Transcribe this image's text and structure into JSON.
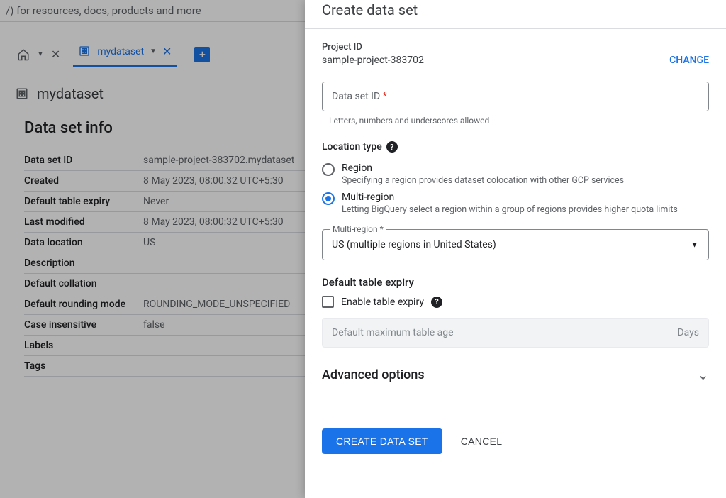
{
  "search": {
    "placeholder_fragment": "/) for resources, docs, products and more"
  },
  "tabs": {
    "dataset_tab": "mydataset"
  },
  "page": {
    "title": "mydataset",
    "section": "Data set info"
  },
  "info_rows": [
    {
      "k": "Data set ID",
      "v": "sample-project-383702.mydataset"
    },
    {
      "k": "Created",
      "v": "8 May 2023, 08:00:32 UTC+5:30"
    },
    {
      "k": "Default table expiry",
      "v": "Never"
    },
    {
      "k": "Last modified",
      "v": "8 May 2023, 08:00:32 UTC+5:30"
    },
    {
      "k": "Data location",
      "v": "US"
    },
    {
      "k": "Description",
      "v": ""
    },
    {
      "k": "Default collation",
      "v": ""
    },
    {
      "k": "Default rounding mode",
      "v": "ROUNDING_MODE_UNSPECIFIED"
    },
    {
      "k": "Case insensitive",
      "v": "false"
    },
    {
      "k": "Labels",
      "v": ""
    },
    {
      "k": "Tags",
      "v": ""
    }
  ],
  "panel": {
    "title": "Create data set",
    "project_id_label": "Project ID",
    "project_id_value": "sample-project-383702",
    "change": "CHANGE",
    "dataset_id_label": "Data set ID",
    "dataset_id_required": "*",
    "dataset_id_hint": "Letters, numbers and underscores allowed",
    "location_type_label": "Location type",
    "radio_region": {
      "title": "Region",
      "desc": "Specifying a region provides dataset colocation with other GCP services"
    },
    "radio_multi": {
      "title": "Multi-region",
      "desc": "Letting BigQuery select a region within a group of regions provides higher quota limits"
    },
    "multi_select_label": "Multi-region *",
    "multi_select_value": "US (multiple regions in United States)",
    "expiry_heading": "Default table expiry",
    "expiry_checkbox": "Enable table expiry",
    "max_age_placeholder": "Default maximum table age",
    "max_age_unit": "Days",
    "advanced": "Advanced options",
    "create_btn": "CREATE DATA SET",
    "cancel_btn": "CANCEL"
  }
}
